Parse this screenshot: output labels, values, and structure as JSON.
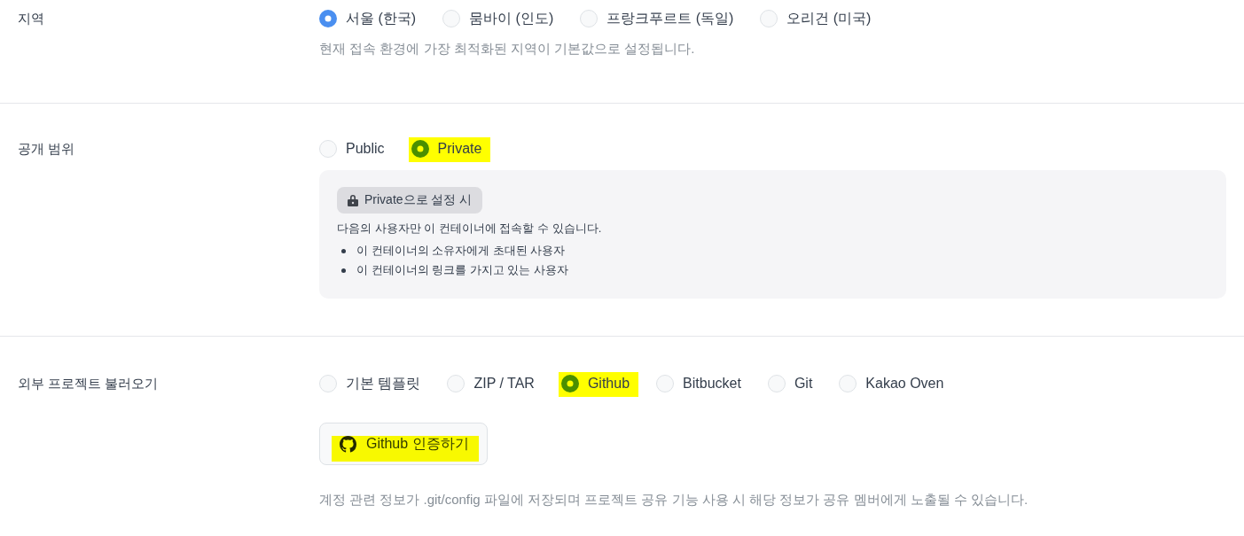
{
  "sections": [
    {
      "label": "지역",
      "options": [
        {
          "label": "서울 (한국)",
          "selected": true,
          "highlighted": false
        },
        {
          "label": "뭄바이 (인도)",
          "selected": false,
          "highlighted": false
        },
        {
          "label": "프랑크푸르트 (독일)",
          "selected": false,
          "highlighted": false
        },
        {
          "label": "오리건 (미국)",
          "selected": false,
          "highlighted": false
        }
      ],
      "help": "현재 접속 환경에 가장 최적화된 지역이 기본값으로 설정됩니다."
    },
    {
      "label": "공개 범위",
      "options": [
        {
          "label": "Public",
          "selected": false,
          "highlighted": false
        },
        {
          "label": "Private",
          "selected": true,
          "highlighted": true
        }
      ],
      "notice": {
        "badge": "Private으로 설정 시",
        "text": "다음의 사용자만 이 컨테이너에 접속할 수 있습니다.",
        "bullets": [
          "이 컨테이너의 소유자에게 초대된 사용자",
          "이 컨테이너의 링크를 가지고 있는 사용자"
        ]
      }
    },
    {
      "label": "외부 프로젝트 불러오기",
      "options": [
        {
          "label": "기본 템플릿",
          "selected": false,
          "highlighted": false
        },
        {
          "label": "ZIP / TAR",
          "selected": false,
          "highlighted": false
        },
        {
          "label": "Github",
          "selected": true,
          "highlighted": true
        },
        {
          "label": "Bitbucket",
          "selected": false,
          "highlighted": false
        },
        {
          "label": "Git",
          "selected": false,
          "highlighted": false
        },
        {
          "label": "Kakao Oven",
          "selected": false,
          "highlighted": false
        }
      ],
      "button": {
        "label": "Github 인증하기",
        "highlighted": true
      },
      "help": "계정 관련 정보가 .git/config 파일에 저장되며 프로젝트 공유 기능 사용 시 해당 정보가 공유 멤버에게 노출될 수 있습니다."
    }
  ]
}
